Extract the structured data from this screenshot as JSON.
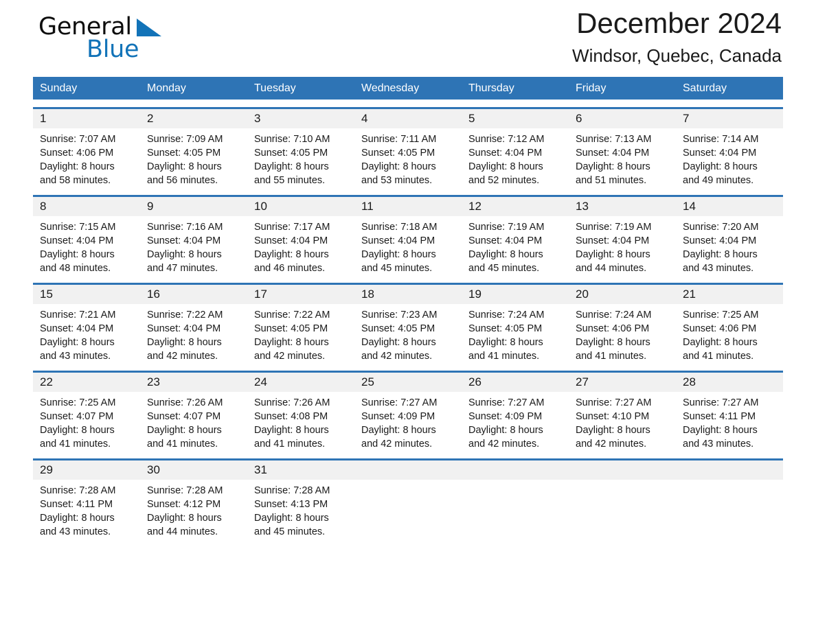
{
  "brand": {
    "name_part1": "General",
    "name_part2": "Blue",
    "triangle_icon": "triangle-icon",
    "color_black": "#0d0d0d",
    "color_blue": "#1273b8"
  },
  "header": {
    "month_title": "December 2024",
    "location": "Windsor, Quebec, Canada"
  },
  "theme": {
    "header_blue": "#2e74b5",
    "daynum_band_gray": "#f1f1f1",
    "text_color": "#1a1a1a",
    "white": "#ffffff"
  },
  "weekdays": [
    "Sunday",
    "Monday",
    "Tuesday",
    "Wednesday",
    "Thursday",
    "Friday",
    "Saturday"
  ],
  "weeks": [
    {
      "days": [
        {
          "num": "1",
          "sunrise": "Sunrise: 7:07 AM",
          "sunset": "Sunset: 4:06 PM",
          "daylight_line1": "Daylight: 8 hours",
          "daylight_line2": "and 58 minutes."
        },
        {
          "num": "2",
          "sunrise": "Sunrise: 7:09 AM",
          "sunset": "Sunset: 4:05 PM",
          "daylight_line1": "Daylight: 8 hours",
          "daylight_line2": "and 56 minutes."
        },
        {
          "num": "3",
          "sunrise": "Sunrise: 7:10 AM",
          "sunset": "Sunset: 4:05 PM",
          "daylight_line1": "Daylight: 8 hours",
          "daylight_line2": "and 55 minutes."
        },
        {
          "num": "4",
          "sunrise": "Sunrise: 7:11 AM",
          "sunset": "Sunset: 4:05 PM",
          "daylight_line1": "Daylight: 8 hours",
          "daylight_line2": "and 53 minutes."
        },
        {
          "num": "5",
          "sunrise": "Sunrise: 7:12 AM",
          "sunset": "Sunset: 4:04 PM",
          "daylight_line1": "Daylight: 8 hours",
          "daylight_line2": "and 52 minutes."
        },
        {
          "num": "6",
          "sunrise": "Sunrise: 7:13 AM",
          "sunset": "Sunset: 4:04 PM",
          "daylight_line1": "Daylight: 8 hours",
          "daylight_line2": "and 51 minutes."
        },
        {
          "num": "7",
          "sunrise": "Sunrise: 7:14 AM",
          "sunset": "Sunset: 4:04 PM",
          "daylight_line1": "Daylight: 8 hours",
          "daylight_line2": "and 49 minutes."
        }
      ]
    },
    {
      "days": [
        {
          "num": "8",
          "sunrise": "Sunrise: 7:15 AM",
          "sunset": "Sunset: 4:04 PM",
          "daylight_line1": "Daylight: 8 hours",
          "daylight_line2": "and 48 minutes."
        },
        {
          "num": "9",
          "sunrise": "Sunrise: 7:16 AM",
          "sunset": "Sunset: 4:04 PM",
          "daylight_line1": "Daylight: 8 hours",
          "daylight_line2": "and 47 minutes."
        },
        {
          "num": "10",
          "sunrise": "Sunrise: 7:17 AM",
          "sunset": "Sunset: 4:04 PM",
          "daylight_line1": "Daylight: 8 hours",
          "daylight_line2": "and 46 minutes."
        },
        {
          "num": "11",
          "sunrise": "Sunrise: 7:18 AM",
          "sunset": "Sunset: 4:04 PM",
          "daylight_line1": "Daylight: 8 hours",
          "daylight_line2": "and 45 minutes."
        },
        {
          "num": "12",
          "sunrise": "Sunrise: 7:19 AM",
          "sunset": "Sunset: 4:04 PM",
          "daylight_line1": "Daylight: 8 hours",
          "daylight_line2": "and 45 minutes."
        },
        {
          "num": "13",
          "sunrise": "Sunrise: 7:19 AM",
          "sunset": "Sunset: 4:04 PM",
          "daylight_line1": "Daylight: 8 hours",
          "daylight_line2": "and 44 minutes."
        },
        {
          "num": "14",
          "sunrise": "Sunrise: 7:20 AM",
          "sunset": "Sunset: 4:04 PM",
          "daylight_line1": "Daylight: 8 hours",
          "daylight_line2": "and 43 minutes."
        }
      ]
    },
    {
      "days": [
        {
          "num": "15",
          "sunrise": "Sunrise: 7:21 AM",
          "sunset": "Sunset: 4:04 PM",
          "daylight_line1": "Daylight: 8 hours",
          "daylight_line2": "and 43 minutes."
        },
        {
          "num": "16",
          "sunrise": "Sunrise: 7:22 AM",
          "sunset": "Sunset: 4:04 PM",
          "daylight_line1": "Daylight: 8 hours",
          "daylight_line2": "and 42 minutes."
        },
        {
          "num": "17",
          "sunrise": "Sunrise: 7:22 AM",
          "sunset": "Sunset: 4:05 PM",
          "daylight_line1": "Daylight: 8 hours",
          "daylight_line2": "and 42 minutes."
        },
        {
          "num": "18",
          "sunrise": "Sunrise: 7:23 AM",
          "sunset": "Sunset: 4:05 PM",
          "daylight_line1": "Daylight: 8 hours",
          "daylight_line2": "and 42 minutes."
        },
        {
          "num": "19",
          "sunrise": "Sunrise: 7:24 AM",
          "sunset": "Sunset: 4:05 PM",
          "daylight_line1": "Daylight: 8 hours",
          "daylight_line2": "and 41 minutes."
        },
        {
          "num": "20",
          "sunrise": "Sunrise: 7:24 AM",
          "sunset": "Sunset: 4:06 PM",
          "daylight_line1": "Daylight: 8 hours",
          "daylight_line2": "and 41 minutes."
        },
        {
          "num": "21",
          "sunrise": "Sunrise: 7:25 AM",
          "sunset": "Sunset: 4:06 PM",
          "daylight_line1": "Daylight: 8 hours",
          "daylight_line2": "and 41 minutes."
        }
      ]
    },
    {
      "days": [
        {
          "num": "22",
          "sunrise": "Sunrise: 7:25 AM",
          "sunset": "Sunset: 4:07 PM",
          "daylight_line1": "Daylight: 8 hours",
          "daylight_line2": "and 41 minutes."
        },
        {
          "num": "23",
          "sunrise": "Sunrise: 7:26 AM",
          "sunset": "Sunset: 4:07 PM",
          "daylight_line1": "Daylight: 8 hours",
          "daylight_line2": "and 41 minutes."
        },
        {
          "num": "24",
          "sunrise": "Sunrise: 7:26 AM",
          "sunset": "Sunset: 4:08 PM",
          "daylight_line1": "Daylight: 8 hours",
          "daylight_line2": "and 41 minutes."
        },
        {
          "num": "25",
          "sunrise": "Sunrise: 7:27 AM",
          "sunset": "Sunset: 4:09 PM",
          "daylight_line1": "Daylight: 8 hours",
          "daylight_line2": "and 42 minutes."
        },
        {
          "num": "26",
          "sunrise": "Sunrise: 7:27 AM",
          "sunset": "Sunset: 4:09 PM",
          "daylight_line1": "Daylight: 8 hours",
          "daylight_line2": "and 42 minutes."
        },
        {
          "num": "27",
          "sunrise": "Sunrise: 7:27 AM",
          "sunset": "Sunset: 4:10 PM",
          "daylight_line1": "Daylight: 8 hours",
          "daylight_line2": "and 42 minutes."
        },
        {
          "num": "28",
          "sunrise": "Sunrise: 7:27 AM",
          "sunset": "Sunset: 4:11 PM",
          "daylight_line1": "Daylight: 8 hours",
          "daylight_line2": "and 43 minutes."
        }
      ]
    },
    {
      "days": [
        {
          "num": "29",
          "sunrise": "Sunrise: 7:28 AM",
          "sunset": "Sunset: 4:11 PM",
          "daylight_line1": "Daylight: 8 hours",
          "daylight_line2": "and 43 minutes."
        },
        {
          "num": "30",
          "sunrise": "Sunrise: 7:28 AM",
          "sunset": "Sunset: 4:12 PM",
          "daylight_line1": "Daylight: 8 hours",
          "daylight_line2": "and 44 minutes."
        },
        {
          "num": "31",
          "sunrise": "Sunrise: 7:28 AM",
          "sunset": "Sunset: 4:13 PM",
          "daylight_line1": "Daylight: 8 hours",
          "daylight_line2": "and 45 minutes."
        },
        {
          "num": "",
          "sunrise": "",
          "sunset": "",
          "daylight_line1": "",
          "daylight_line2": ""
        },
        {
          "num": "",
          "sunrise": "",
          "sunset": "",
          "daylight_line1": "",
          "daylight_line2": ""
        },
        {
          "num": "",
          "sunrise": "",
          "sunset": "",
          "daylight_line1": "",
          "daylight_line2": ""
        },
        {
          "num": "",
          "sunrise": "",
          "sunset": "",
          "daylight_line1": "",
          "daylight_line2": ""
        }
      ]
    }
  ]
}
